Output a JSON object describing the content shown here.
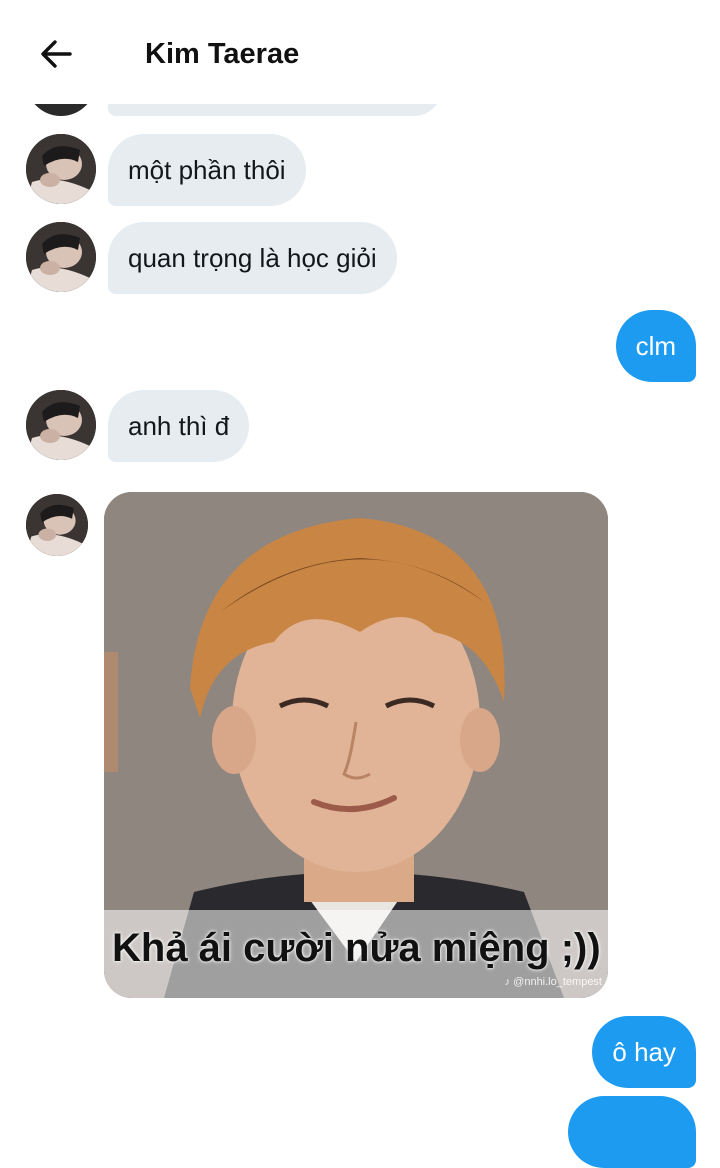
{
  "header": {
    "title": "Kim Taerae",
    "back_icon": "arrow-left-icon"
  },
  "messages": [
    {
      "side": "incoming",
      "text": "một phần thôi"
    },
    {
      "side": "incoming",
      "text": "quan trọng là học giỏi"
    },
    {
      "side": "outgoing",
      "text": "clm"
    },
    {
      "side": "incoming",
      "text": "anh thì đ"
    },
    {
      "side": "incoming",
      "type": "image",
      "caption": "Khả ái cười nửa miệng ;))",
      "watermark": "♪ @nnhi.lo_tempest"
    },
    {
      "side": "outgoing",
      "text": "ô hay"
    }
  ],
  "colors": {
    "incoming_bubble": "#e6ecf0",
    "outgoing_bubble": "#1d9bf0",
    "incoming_text": "#14171a",
    "outgoing_text": "#ffffff"
  }
}
